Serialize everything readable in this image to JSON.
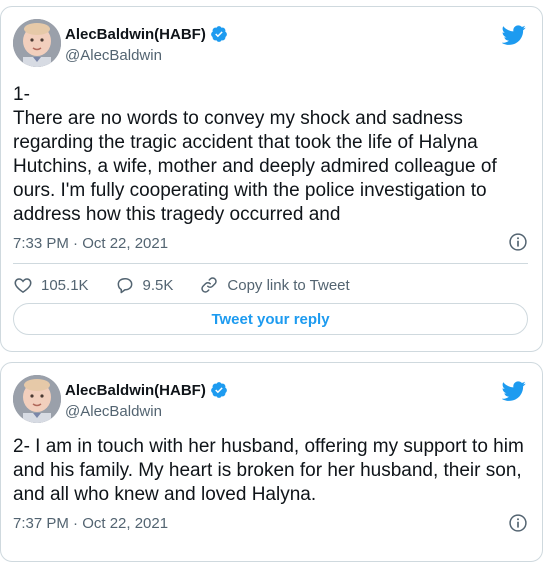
{
  "tweets": [
    {
      "author": {
        "display_name": "AlecBaldwin(HABF)",
        "handle": "@AlecBaldwin",
        "verified": true
      },
      "text": "1-\nThere are no words to convey my shock and sadness regarding the tragic accident that took the life of Halyna Hutchins, a wife, mother and deeply admired colleague of ours. I'm fully cooperating with the police investigation to address how this tragedy occurred and",
      "timestamp": "7:33 PM · Oct 22, 2021",
      "likes": "105.1K",
      "replies": "9.5K",
      "copy_link_label": "Copy link to Tweet",
      "reply_button_label": "Tweet your reply"
    },
    {
      "author": {
        "display_name": "AlecBaldwin(HABF)",
        "handle": "@AlecBaldwin",
        "verified": true
      },
      "text": "2- I am in touch with her husband, offering my support to him and his family. My heart is broken for her husband, their son, and all who knew and loved Halyna.",
      "timestamp": "7:37 PM · Oct 22, 2021"
    }
  ],
  "icons": {
    "brand": "twitter-bird-icon",
    "verified": "verified-badge-icon",
    "like": "heart-icon",
    "reply": "speech-bubble-icon",
    "copy_link": "link-icon",
    "info": "info-icon"
  },
  "colors": {
    "accent": "#1d9bf0",
    "text": "#0f1419",
    "muted": "#536471",
    "border": "#cfd9de"
  }
}
